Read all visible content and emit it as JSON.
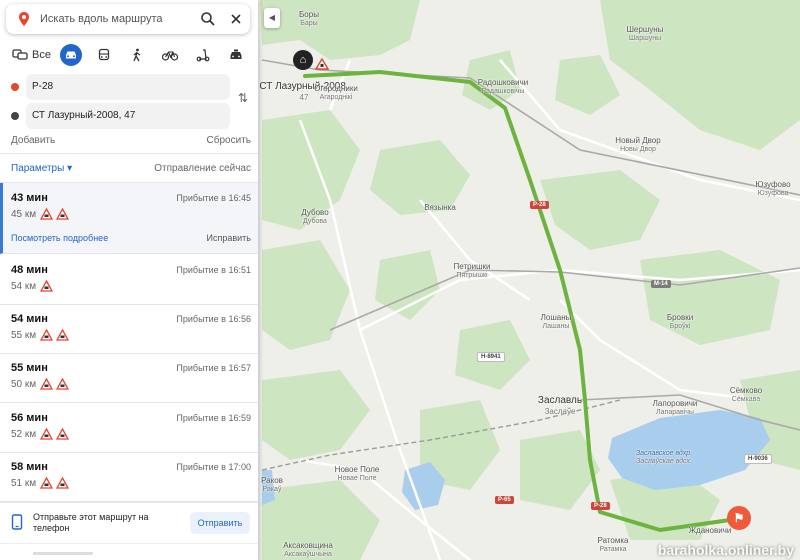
{
  "search": {
    "placeholder": "Искать вдоль маршрута"
  },
  "modes": {
    "all_label": "Все",
    "active": "car"
  },
  "waypoints": {
    "from": "Р-28",
    "to": "СТ Лазурный-2008, 47"
  },
  "actions": {
    "add": "Добавить",
    "reset": "Сбросить"
  },
  "params": {
    "label": "Параметры ▾",
    "departure": "Отправление сейчас"
  },
  "routes": [
    {
      "time": "43 мин",
      "distance": "45 км",
      "arrival": "Прибытие в 16:45",
      "warnings": 2,
      "details": "Посмотреть подробнее",
      "fix": "Исправить"
    },
    {
      "time": "48 мин",
      "distance": "54 км",
      "arrival": "Прибытие в 16:51",
      "warnings": 1
    },
    {
      "time": "54 мин",
      "distance": "55 км",
      "arrival": "Прибытие в 16:56",
      "warnings": 2
    },
    {
      "time": "55 мин",
      "distance": "50 км",
      "arrival": "Прибытие в 16:57",
      "warnings": 2
    },
    {
      "time": "56 мин",
      "distance": "52 км",
      "arrival": "Прибытие в 16:59",
      "warnings": 2
    },
    {
      "time": "58 мин",
      "distance": "51 км",
      "arrival": "Прибытие в 17:00",
      "warnings": 2
    }
  ],
  "send": {
    "text": "Отправьте этот маршрут на телефон",
    "button": "Отправить"
  },
  "colors": {
    "accent": "#2266cc",
    "route": "#6db33f",
    "start_dot": "#e6452f",
    "end_pin": "#ef5a3c",
    "forest": "#cfe8c4",
    "water": "#a9cdec"
  },
  "map": {
    "places": [
      {
        "name": "Боры",
        "sub": "Бары",
        "big": false
      },
      {
        "name": "СТ Лазурный-2008,",
        "sub": "47",
        "big": true
      },
      {
        "name": "Огородники",
        "sub": "Агароднікі",
        "big": false
      },
      {
        "name": "Радошковичи",
        "sub": "Радашковічы",
        "big": false
      },
      {
        "name": "Шершуны",
        "sub": "Шаршуны",
        "big": false
      },
      {
        "name": "Новый Двор",
        "sub": "Новы Двор",
        "big": false
      },
      {
        "name": "Юзуфово",
        "sub": "Юзуфова",
        "big": false
      },
      {
        "name": "Вязынка",
        "sub": "",
        "big": false
      },
      {
        "name": "Дубово",
        "sub": "Дубова",
        "big": false
      },
      {
        "name": "Петришки",
        "sub": "Пятрышкі",
        "big": false
      },
      {
        "name": "Лошаны",
        "sub": "Лашаны",
        "big": false
      },
      {
        "name": "Бровки",
        "sub": "Броўкі",
        "big": false
      },
      {
        "name": "Заславль",
        "sub": "Заслаўе",
        "big": true
      },
      {
        "name": "Лапоровичи",
        "sub": "Лапаравічы",
        "big": false
      },
      {
        "name": "Сёмково",
        "sub": "Сёмкава",
        "big": false
      },
      {
        "name": "Новое Поле",
        "sub": "Новае Поле",
        "big": false
      },
      {
        "name": "Раков",
        "sub": "Ракаў",
        "big": false
      },
      {
        "name": "Ратомка",
        "sub": "Ратамка",
        "big": false
      },
      {
        "name": "Ждановичи",
        "sub": "",
        "big": false
      },
      {
        "name": "Аксаковщина",
        "sub": "Аксакаўшчына",
        "big": false
      }
    ],
    "water_labels": [
      {
        "name": "Заславское вдхр.",
        "sub": "Заслаўскае вдсх."
      }
    ],
    "road_badges": [
      {
        "name": "Р-28",
        "kind": "red"
      },
      {
        "name": "М-14",
        "kind": "grey"
      },
      {
        "name": "Н-8941",
        "kind": "white"
      },
      {
        "name": "Н-9036",
        "kind": "white"
      },
      {
        "name": "Р-65",
        "kind": "red"
      },
      {
        "name": "Р-28",
        "kind": "red"
      }
    ],
    "watermark": "baraholka.onliner.by"
  }
}
